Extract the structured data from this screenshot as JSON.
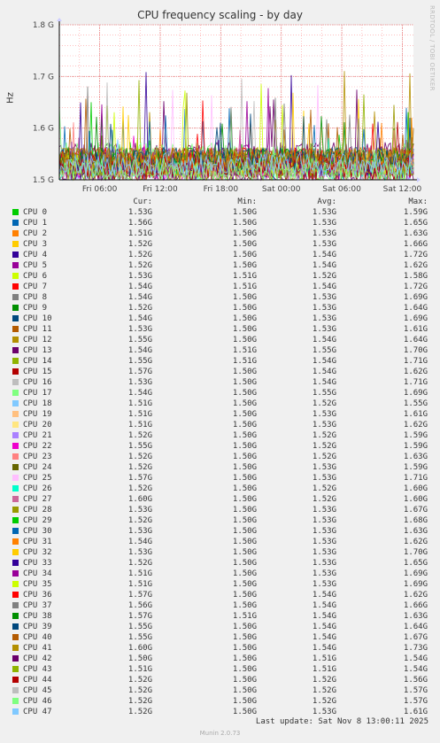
{
  "title": "CPU frequency scaling - by day",
  "side_credit": "RRDTOOL / TOBI OETIKER",
  "ylabel": "Hz",
  "footer": {
    "last_update": "Last update:  Sat Nov  8 13:00:11 2025",
    "munin": "Munin 2.0.73"
  },
  "legend_header": {
    "cur": "Cur:",
    "min": "Min:",
    "avg": "Avg:",
    "max": "Max:"
  },
  "chart_data": {
    "type": "line",
    "title": "CPU frequency scaling - by day",
    "ylabel": "Hz",
    "ylim": [
      1.5,
      1.8
    ],
    "yticks": [
      "1.5 G",
      "1.6 G",
      "1.7 G",
      "1.8 G"
    ],
    "yticks_values": [
      1.5,
      1.6,
      1.7,
      1.8
    ],
    "xticks": [
      "Fri 06:00",
      "Fri 12:00",
      "Fri 18:00",
      "Sat 00:00",
      "Sat 06:00",
      "Sat 12:00"
    ],
    "xticks_hours": [
      6,
      12,
      18,
      24,
      30,
      36
    ],
    "xlim_hours": [
      2,
      37.1
    ],
    "grid": true,
    "series": [
      {
        "name": "CPU 0",
        "color": "#00cc00",
        "cur": "1.53G",
        "min": "1.50G",
        "avg": "1.53G",
        "max": "1.59G"
      },
      {
        "name": "CPU 1",
        "color": "#0066b3",
        "cur": "1.56G",
        "min": "1.50G",
        "avg": "1.53G",
        "max": "1.65G"
      },
      {
        "name": "CPU 2",
        "color": "#ff8000",
        "cur": "1.51G",
        "min": "1.50G",
        "avg": "1.53G",
        "max": "1.63G"
      },
      {
        "name": "CPU 3",
        "color": "#ffcc00",
        "cur": "1.52G",
        "min": "1.50G",
        "avg": "1.53G",
        "max": "1.66G"
      },
      {
        "name": "CPU 4",
        "color": "#330099",
        "cur": "1.52G",
        "min": "1.50G",
        "avg": "1.54G",
        "max": "1.72G"
      },
      {
        "name": "CPU 5",
        "color": "#990099",
        "cur": "1.52G",
        "min": "1.50G",
        "avg": "1.54G",
        "max": "1.62G"
      },
      {
        "name": "CPU 6",
        "color": "#ccff00",
        "cur": "1.53G",
        "min": "1.51G",
        "avg": "1.52G",
        "max": "1.58G"
      },
      {
        "name": "CPU 7",
        "color": "#ff0000",
        "cur": "1.54G",
        "min": "1.51G",
        "avg": "1.54G",
        "max": "1.72G"
      },
      {
        "name": "CPU 8",
        "color": "#808080",
        "cur": "1.54G",
        "min": "1.50G",
        "avg": "1.53G",
        "max": "1.69G"
      },
      {
        "name": "CPU 9",
        "color": "#008f00",
        "cur": "1.52G",
        "min": "1.50G",
        "avg": "1.53G",
        "max": "1.64G"
      },
      {
        "name": "CPU 10",
        "color": "#00487d",
        "cur": "1.54G",
        "min": "1.50G",
        "avg": "1.53G",
        "max": "1.69G"
      },
      {
        "name": "CPU 11",
        "color": "#b35a00",
        "cur": "1.53G",
        "min": "1.50G",
        "avg": "1.53G",
        "max": "1.61G"
      },
      {
        "name": "CPU 12",
        "color": "#b38f00",
        "cur": "1.55G",
        "min": "1.50G",
        "avg": "1.54G",
        "max": "1.64G"
      },
      {
        "name": "CPU 13",
        "color": "#6b006b",
        "cur": "1.54G",
        "min": "1.51G",
        "avg": "1.55G",
        "max": "1.70G"
      },
      {
        "name": "CPU 14",
        "color": "#8fb300",
        "cur": "1.55G",
        "min": "1.51G",
        "avg": "1.54G",
        "max": "1.71G"
      },
      {
        "name": "CPU 15",
        "color": "#b30000",
        "cur": "1.57G",
        "min": "1.50G",
        "avg": "1.54G",
        "max": "1.62G"
      },
      {
        "name": "CPU 16",
        "color": "#bebebe",
        "cur": "1.53G",
        "min": "1.50G",
        "avg": "1.54G",
        "max": "1.71G"
      },
      {
        "name": "CPU 17",
        "color": "#80ff80",
        "cur": "1.54G",
        "min": "1.50G",
        "avg": "1.55G",
        "max": "1.69G"
      },
      {
        "name": "CPU 18",
        "color": "#80c9ff",
        "cur": "1.51G",
        "min": "1.50G",
        "avg": "1.52G",
        "max": "1.55G"
      },
      {
        "name": "CPU 19",
        "color": "#ffc080",
        "cur": "1.51G",
        "min": "1.50G",
        "avg": "1.53G",
        "max": "1.61G"
      },
      {
        "name": "CPU 20",
        "color": "#ffe680",
        "cur": "1.51G",
        "min": "1.50G",
        "avg": "1.53G",
        "max": "1.62G"
      },
      {
        "name": "CPU 21",
        "color": "#aa80ff",
        "cur": "1.52G",
        "min": "1.50G",
        "avg": "1.52G",
        "max": "1.59G"
      },
      {
        "name": "CPU 22",
        "color": "#ee00cc",
        "cur": "1.55G",
        "min": "1.50G",
        "avg": "1.52G",
        "max": "1.59G"
      },
      {
        "name": "CPU 23",
        "color": "#ff8080",
        "cur": "1.52G",
        "min": "1.50G",
        "avg": "1.52G",
        "max": "1.63G"
      },
      {
        "name": "CPU 24",
        "color": "#666600",
        "cur": "1.52G",
        "min": "1.50G",
        "avg": "1.53G",
        "max": "1.59G"
      },
      {
        "name": "CPU 25",
        "color": "#ffbfff",
        "cur": "1.57G",
        "min": "1.50G",
        "avg": "1.53G",
        "max": "1.71G"
      },
      {
        "name": "CPU 26",
        "color": "#00ffcc",
        "cur": "1.52G",
        "min": "1.50G",
        "avg": "1.52G",
        "max": "1.60G"
      },
      {
        "name": "CPU 27",
        "color": "#cc6699",
        "cur": "1.60G",
        "min": "1.50G",
        "avg": "1.52G",
        "max": "1.60G"
      },
      {
        "name": "CPU 28",
        "color": "#999900",
        "cur": "1.53G",
        "min": "1.50G",
        "avg": "1.53G",
        "max": "1.67G"
      },
      {
        "name": "CPU 29",
        "color": "#00cc00",
        "cur": "1.52G",
        "min": "1.50G",
        "avg": "1.53G",
        "max": "1.68G"
      },
      {
        "name": "CPU 30",
        "color": "#0066b3",
        "cur": "1.53G",
        "min": "1.50G",
        "avg": "1.53G",
        "max": "1.63G"
      },
      {
        "name": "CPU 31",
        "color": "#ff8000",
        "cur": "1.54G",
        "min": "1.50G",
        "avg": "1.53G",
        "max": "1.62G"
      },
      {
        "name": "CPU 32",
        "color": "#ffcc00",
        "cur": "1.53G",
        "min": "1.50G",
        "avg": "1.53G",
        "max": "1.70G"
      },
      {
        "name": "CPU 33",
        "color": "#330099",
        "cur": "1.52G",
        "min": "1.50G",
        "avg": "1.53G",
        "max": "1.65G"
      },
      {
        "name": "CPU 34",
        "color": "#990099",
        "cur": "1.51G",
        "min": "1.50G",
        "avg": "1.53G",
        "max": "1.69G"
      },
      {
        "name": "CPU 35",
        "color": "#ccff00",
        "cur": "1.51G",
        "min": "1.50G",
        "avg": "1.53G",
        "max": "1.69G"
      },
      {
        "name": "CPU 36",
        "color": "#ff0000",
        "cur": "1.57G",
        "min": "1.50G",
        "avg": "1.54G",
        "max": "1.62G"
      },
      {
        "name": "CPU 37",
        "color": "#808080",
        "cur": "1.56G",
        "min": "1.50G",
        "avg": "1.54G",
        "max": "1.66G"
      },
      {
        "name": "CPU 38",
        "color": "#008f00",
        "cur": "1.57G",
        "min": "1.51G",
        "avg": "1.54G",
        "max": "1.63G"
      },
      {
        "name": "CPU 39",
        "color": "#00487d",
        "cur": "1.55G",
        "min": "1.50G",
        "avg": "1.54G",
        "max": "1.64G"
      },
      {
        "name": "CPU 40",
        "color": "#b35a00",
        "cur": "1.55G",
        "min": "1.50G",
        "avg": "1.54G",
        "max": "1.67G"
      },
      {
        "name": "CPU 41",
        "color": "#b38f00",
        "cur": "1.60G",
        "min": "1.50G",
        "avg": "1.54G",
        "max": "1.73G"
      },
      {
        "name": "CPU 42",
        "color": "#6b006b",
        "cur": "1.50G",
        "min": "1.50G",
        "avg": "1.51G",
        "max": "1.54G"
      },
      {
        "name": "CPU 43",
        "color": "#8fb300",
        "cur": "1.51G",
        "min": "1.50G",
        "avg": "1.51G",
        "max": "1.54G"
      },
      {
        "name": "CPU 44",
        "color": "#b30000",
        "cur": "1.52G",
        "min": "1.50G",
        "avg": "1.52G",
        "max": "1.56G"
      },
      {
        "name": "CPU 45",
        "color": "#bebebe",
        "cur": "1.52G",
        "min": "1.50G",
        "avg": "1.52G",
        "max": "1.57G"
      },
      {
        "name": "CPU 46",
        "color": "#80ff80",
        "cur": "1.52G",
        "min": "1.50G",
        "avg": "1.52G",
        "max": "1.57G"
      },
      {
        "name": "CPU 47",
        "color": "#80c9ff",
        "cur": "1.52G",
        "min": "1.50G",
        "avg": "1.53G",
        "max": "1.61G"
      }
    ]
  }
}
